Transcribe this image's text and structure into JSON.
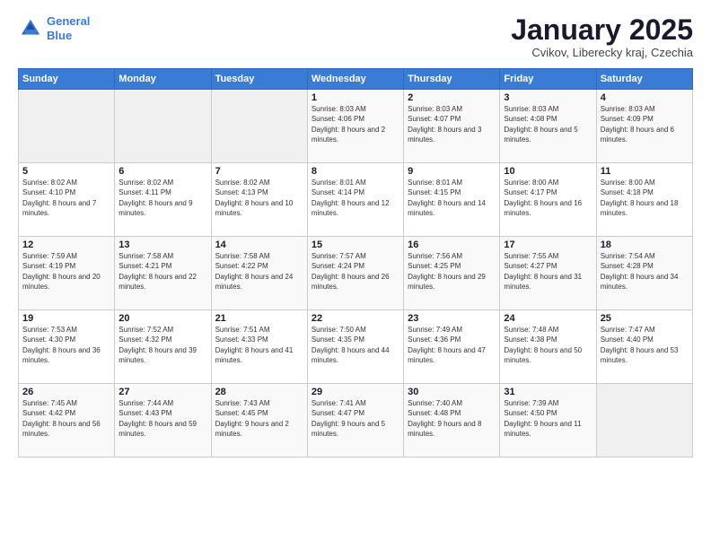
{
  "logo": {
    "line1": "General",
    "line2": "Blue"
  },
  "title": "January 2025",
  "subtitle": "Cvikov, Liberecky kraj, Czechia",
  "headers": [
    "Sunday",
    "Monday",
    "Tuesday",
    "Wednesday",
    "Thursday",
    "Friday",
    "Saturday"
  ],
  "weeks": [
    [
      {
        "day": "",
        "info": ""
      },
      {
        "day": "",
        "info": ""
      },
      {
        "day": "",
        "info": ""
      },
      {
        "day": "1",
        "info": "Sunrise: 8:03 AM\nSunset: 4:06 PM\nDaylight: 8 hours and 2 minutes."
      },
      {
        "day": "2",
        "info": "Sunrise: 8:03 AM\nSunset: 4:07 PM\nDaylight: 8 hours and 3 minutes."
      },
      {
        "day": "3",
        "info": "Sunrise: 8:03 AM\nSunset: 4:08 PM\nDaylight: 8 hours and 5 minutes."
      },
      {
        "day": "4",
        "info": "Sunrise: 8:03 AM\nSunset: 4:09 PM\nDaylight: 8 hours and 6 minutes."
      }
    ],
    [
      {
        "day": "5",
        "info": "Sunrise: 8:02 AM\nSunset: 4:10 PM\nDaylight: 8 hours and 7 minutes."
      },
      {
        "day": "6",
        "info": "Sunrise: 8:02 AM\nSunset: 4:11 PM\nDaylight: 8 hours and 9 minutes."
      },
      {
        "day": "7",
        "info": "Sunrise: 8:02 AM\nSunset: 4:13 PM\nDaylight: 8 hours and 10 minutes."
      },
      {
        "day": "8",
        "info": "Sunrise: 8:01 AM\nSunset: 4:14 PM\nDaylight: 8 hours and 12 minutes."
      },
      {
        "day": "9",
        "info": "Sunrise: 8:01 AM\nSunset: 4:15 PM\nDaylight: 8 hours and 14 minutes."
      },
      {
        "day": "10",
        "info": "Sunrise: 8:00 AM\nSunset: 4:17 PM\nDaylight: 8 hours and 16 minutes."
      },
      {
        "day": "11",
        "info": "Sunrise: 8:00 AM\nSunset: 4:18 PM\nDaylight: 8 hours and 18 minutes."
      }
    ],
    [
      {
        "day": "12",
        "info": "Sunrise: 7:59 AM\nSunset: 4:19 PM\nDaylight: 8 hours and 20 minutes."
      },
      {
        "day": "13",
        "info": "Sunrise: 7:58 AM\nSunset: 4:21 PM\nDaylight: 8 hours and 22 minutes."
      },
      {
        "day": "14",
        "info": "Sunrise: 7:58 AM\nSunset: 4:22 PM\nDaylight: 8 hours and 24 minutes."
      },
      {
        "day": "15",
        "info": "Sunrise: 7:57 AM\nSunset: 4:24 PM\nDaylight: 8 hours and 26 minutes."
      },
      {
        "day": "16",
        "info": "Sunrise: 7:56 AM\nSunset: 4:25 PM\nDaylight: 8 hours and 29 minutes."
      },
      {
        "day": "17",
        "info": "Sunrise: 7:55 AM\nSunset: 4:27 PM\nDaylight: 8 hours and 31 minutes."
      },
      {
        "day": "18",
        "info": "Sunrise: 7:54 AM\nSunset: 4:28 PM\nDaylight: 8 hours and 34 minutes."
      }
    ],
    [
      {
        "day": "19",
        "info": "Sunrise: 7:53 AM\nSunset: 4:30 PM\nDaylight: 8 hours and 36 minutes."
      },
      {
        "day": "20",
        "info": "Sunrise: 7:52 AM\nSunset: 4:32 PM\nDaylight: 8 hours and 39 minutes."
      },
      {
        "day": "21",
        "info": "Sunrise: 7:51 AM\nSunset: 4:33 PM\nDaylight: 8 hours and 41 minutes."
      },
      {
        "day": "22",
        "info": "Sunrise: 7:50 AM\nSunset: 4:35 PM\nDaylight: 8 hours and 44 minutes."
      },
      {
        "day": "23",
        "info": "Sunrise: 7:49 AM\nSunset: 4:36 PM\nDaylight: 8 hours and 47 minutes."
      },
      {
        "day": "24",
        "info": "Sunrise: 7:48 AM\nSunset: 4:38 PM\nDaylight: 8 hours and 50 minutes."
      },
      {
        "day": "25",
        "info": "Sunrise: 7:47 AM\nSunset: 4:40 PM\nDaylight: 8 hours and 53 minutes."
      }
    ],
    [
      {
        "day": "26",
        "info": "Sunrise: 7:45 AM\nSunset: 4:42 PM\nDaylight: 8 hours and 56 minutes."
      },
      {
        "day": "27",
        "info": "Sunrise: 7:44 AM\nSunset: 4:43 PM\nDaylight: 8 hours and 59 minutes."
      },
      {
        "day": "28",
        "info": "Sunrise: 7:43 AM\nSunset: 4:45 PM\nDaylight: 9 hours and 2 minutes."
      },
      {
        "day": "29",
        "info": "Sunrise: 7:41 AM\nSunset: 4:47 PM\nDaylight: 9 hours and 5 minutes."
      },
      {
        "day": "30",
        "info": "Sunrise: 7:40 AM\nSunset: 4:48 PM\nDaylight: 9 hours and 8 minutes."
      },
      {
        "day": "31",
        "info": "Sunrise: 7:39 AM\nSunset: 4:50 PM\nDaylight: 9 hours and 11 minutes."
      },
      {
        "day": "",
        "info": ""
      }
    ]
  ]
}
